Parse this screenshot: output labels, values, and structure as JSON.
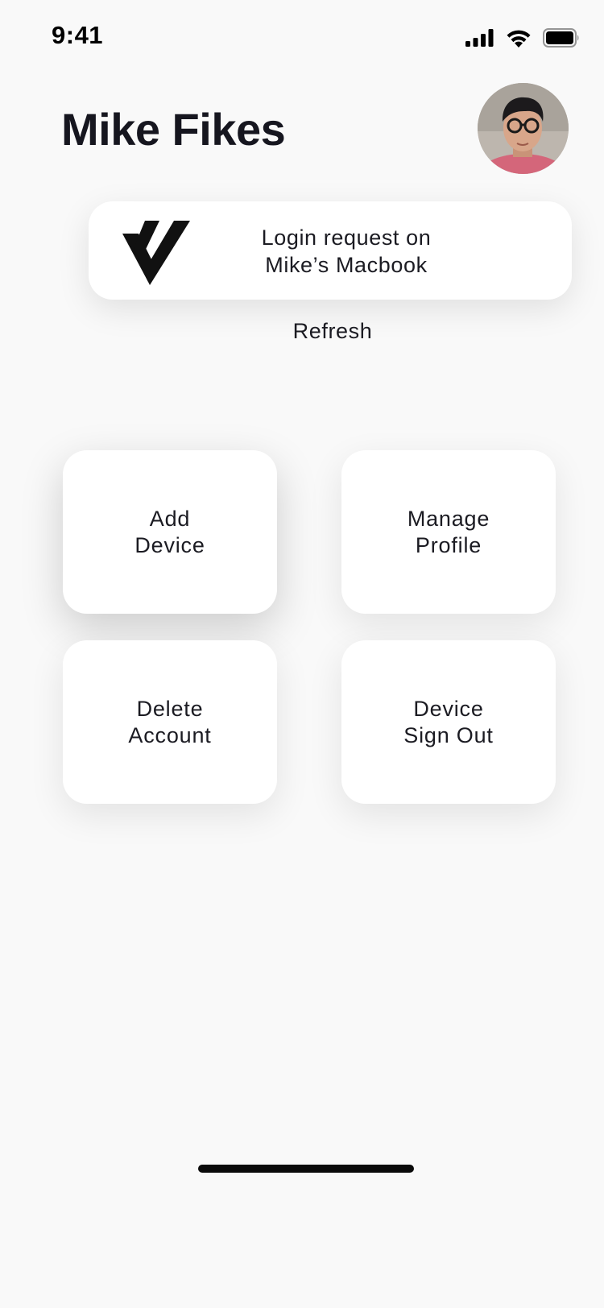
{
  "status_bar": {
    "time": "9:41",
    "icons": [
      "cellular-signal-icon",
      "wifi-icon",
      "battery-icon"
    ]
  },
  "header": {
    "name": "Mike Fikes",
    "avatar": "avatar-photo"
  },
  "notification": {
    "logo": "v-logo-icon",
    "line1": "Login request on",
    "line2": "Mike’s Macbook"
  },
  "refresh_label": "Refresh",
  "tiles": [
    {
      "line1": "Add",
      "line2": "Device"
    },
    {
      "line1": "Manage",
      "line2": "Profile"
    },
    {
      "line1": "Delete",
      "line2": "Account"
    },
    {
      "line1": "Device",
      "line2": "Sign Out"
    }
  ],
  "colors": {
    "background": "#f9f9f9",
    "card": "#ffffff",
    "text": "#1b1b22"
  }
}
